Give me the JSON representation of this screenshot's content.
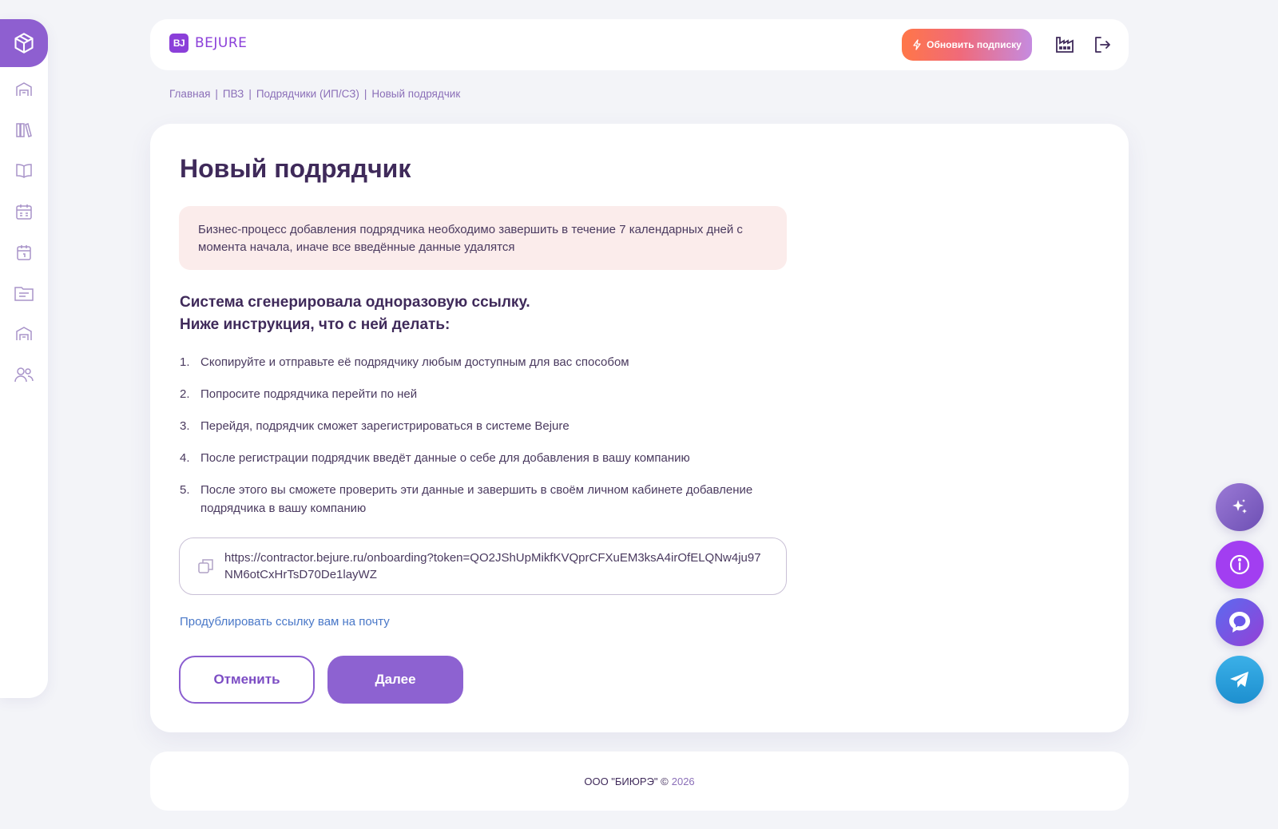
{
  "app": {
    "brand_mark": "BJ",
    "brand_name": "BEJURE"
  },
  "header": {
    "upgrade_label": "Обновить подписку",
    "icons": [
      "lightning-icon",
      "factory-icon",
      "logout-icon"
    ]
  },
  "sidebar": {
    "items": [
      {
        "name": "box-icon",
        "active": true
      },
      {
        "name": "warehouse-icon"
      },
      {
        "name": "library-icon"
      },
      {
        "name": "book-icon"
      },
      {
        "name": "calendar-grid-icon"
      },
      {
        "name": "calendar-icon"
      },
      {
        "name": "folder-icon"
      },
      {
        "name": "warehouse-icon"
      },
      {
        "name": "users-icon"
      }
    ]
  },
  "breadcrumb": {
    "items": [
      "Главная",
      "ПВЗ",
      "Подрядчики (ИП/СЗ)",
      "Новый подрядчик"
    ],
    "separator": "|"
  },
  "main": {
    "title": "Новый подрядчик",
    "alert": "Бизнес-процесс добавления подрядчика необходимо завершить в течение 7 календарных дней с момента начала, иначе все введённые данные удалятся",
    "subhead_line1": "Система сгенерировала одноразовую ссылку.",
    "subhead_line2": "Ниже инструкция, что с ней делать:",
    "steps": [
      {
        "num": "1.",
        "text": "Скопируйте и отправьте её подрядчику любым доступным для вас способом"
      },
      {
        "num": "2.",
        "text": "Попросите подрядчика перейти по ней"
      },
      {
        "num": "3.",
        "text": "Перейдя, подрядчик сможет зарегистрироваться в системе Bejure"
      },
      {
        "num": "4.",
        "text": "После регистрации подрядчик введёт данные о себе для добавления в вашу компанию"
      },
      {
        "num": "5.",
        "text": "После этого вы сможете проверить эти данные и завершить в своём личном кабинете добавление подрядчика в вашу компанию"
      }
    ],
    "link_url": "https://contractor.bejure.ru/onboarding?token=QO2JShUpMikfKVQprCFXuEM3ksA4irOfELQNw4ju97NM6otCxHrTsD70De1layWZ",
    "duplicate_link": "Продублировать ссылку вам на почту",
    "cancel_label": "Отменить",
    "next_label": "Далее"
  },
  "footer": {
    "company": "ООО \"БИЮРЭ\" ©",
    "year": "2026"
  },
  "fabs": [
    "sparkles-icon",
    "info-icon",
    "chat-icon",
    "telegram-icon"
  ],
  "colors": {
    "accent": "#8d62d1",
    "brand": "#8b3fd9",
    "alert_bg": "#fbeceb",
    "link": "#4a78c8"
  }
}
